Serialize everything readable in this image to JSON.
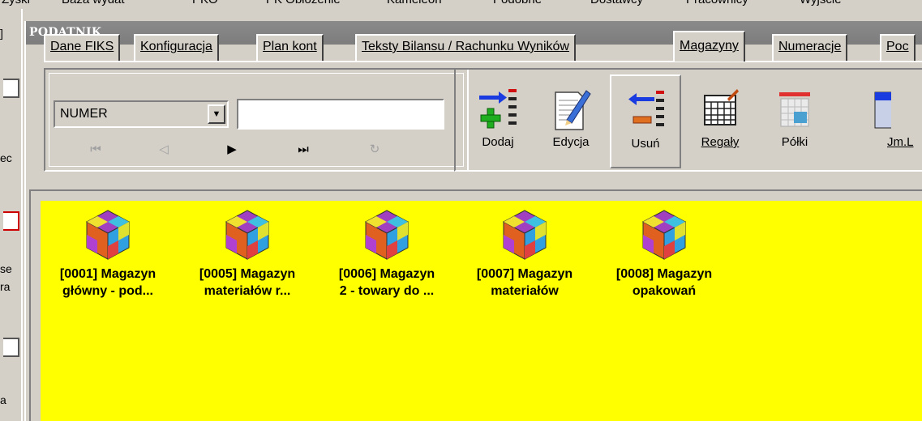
{
  "menu": [
    "Zyski",
    "Baza wydat",
    "PKO",
    "PK Obłożenie",
    "Kameleon",
    "Podobne",
    "Dostawcy",
    "Pracownicy",
    "Wyjście"
  ],
  "left_fragments": [
    "]",
    "ec",
    "se",
    "ra",
    "a"
  ],
  "window": {
    "title": "PODATNIK"
  },
  "tabs": [
    {
      "label": "Dane FIKS",
      "active": false
    },
    {
      "label": "Konfiguracja",
      "active": false
    },
    {
      "label": "Plan kont",
      "active": false
    },
    {
      "label": "Teksty Bilansu / Rachunku Wyników",
      "active": false
    },
    {
      "label": "Magazyny",
      "active": true
    },
    {
      "label": "Numeracje",
      "active": false
    },
    {
      "label": "Poc",
      "active": false
    }
  ],
  "navigator": {
    "field": "NUMER",
    "search_value": "",
    "buttons": [
      {
        "glyph": "⏮",
        "name": "first-record-button",
        "enabled": false
      },
      {
        "glyph": "◁",
        "name": "prev-record-button",
        "enabled": false
      },
      {
        "glyph": "▶",
        "name": "next-record-button",
        "enabled": true
      },
      {
        "glyph": "⏭",
        "name": "last-record-button",
        "enabled": true
      },
      {
        "glyph": "↻",
        "name": "refresh-button",
        "enabled": false
      }
    ]
  },
  "toolbar": {
    "add": "Dodaj",
    "edit": "Edycja",
    "delete": "Usuń",
    "racks": "Regały",
    "shelves": "Półki",
    "units": "Jm.L"
  },
  "warehouses": [
    {
      "line1": "[0001] Magazyn",
      "line2": "główny - pod..."
    },
    {
      "line1": "[0005] Magazyn",
      "line2": "materiałów r..."
    },
    {
      "line1": "[0006] Magazyn",
      "line2": "2 - towary do ..."
    },
    {
      "line1": "[0007] Magazyn",
      "line2": "materiałów"
    },
    {
      "line1": "[0008] Magazyn",
      "line2": "opakowań"
    }
  ],
  "colors": {
    "workarea": "#ffff00",
    "face": "#d4d0c8",
    "titlebar": "#808080"
  }
}
